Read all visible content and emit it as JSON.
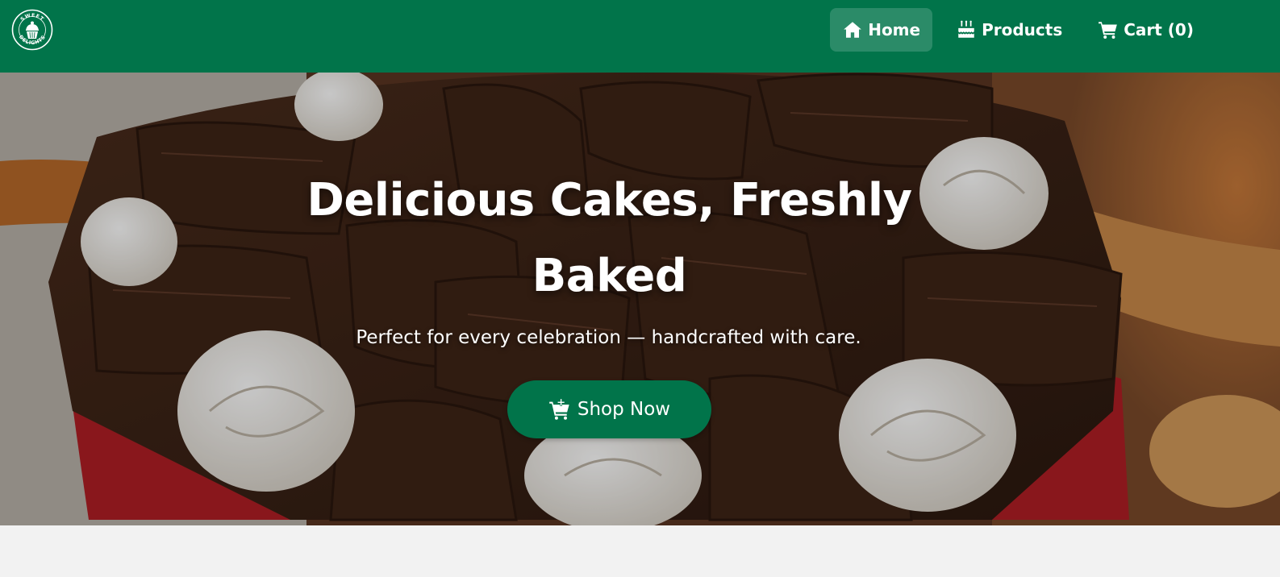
{
  "brand": {
    "logo_line1": "SWEET",
    "logo_line2": "DELIGHTS",
    "logo_icon": "cupcake-icon"
  },
  "nav": {
    "home_label": "Home",
    "home_icon": "home-icon",
    "products_label": "Products",
    "products_icon": "birthday-cake-icon",
    "cart_label": "Cart (0)",
    "cart_icon": "cart-icon",
    "active": "Home"
  },
  "hero": {
    "title": "Delicious Cakes, Freshly Baked",
    "subtitle": "Perfect for every celebration — handcrafted with care.",
    "cta_label": "Shop Now",
    "cta_icon": "cart-plus-icon",
    "background": "chocolate-curl-cake-photo"
  },
  "colors": {
    "brand_green": "#01744a",
    "page_background": "#f2f2f2",
    "text_on_dark": "#ffffff"
  }
}
